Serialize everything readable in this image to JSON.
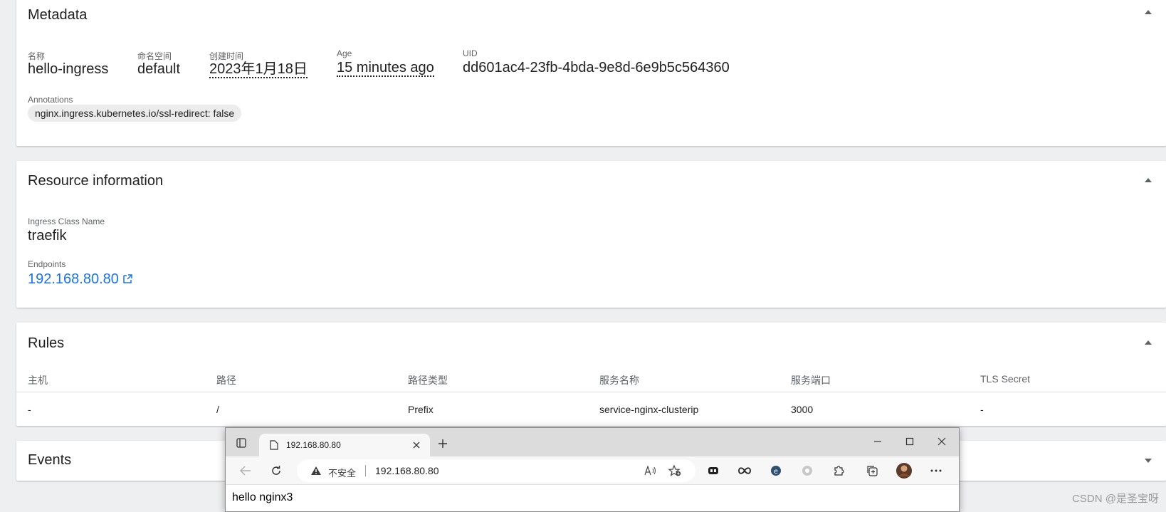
{
  "metadata": {
    "title": "Metadata",
    "fields": {
      "name": {
        "label": "名称",
        "value": "hello-ingress"
      },
      "namespace": {
        "label": "命名空间",
        "value": "default"
      },
      "created": {
        "label": "创建时间",
        "value": "2023年1月18日"
      },
      "age": {
        "label": "Age",
        "value": "15 minutes ago"
      },
      "uid": {
        "label": "UID",
        "value": "dd601ac4-23fb-4bda-9e8d-6e9b5c564360"
      }
    },
    "annotations_label": "Annotations",
    "annotation_chip": "nginx.ingress.kubernetes.io/ssl-redirect: false"
  },
  "resource": {
    "title": "Resource information",
    "ingress_class_label": "Ingress Class Name",
    "ingress_class_value": "traefik",
    "endpoints_label": "Endpoints",
    "endpoint_value": "192.168.80.80"
  },
  "rules": {
    "title": "Rules",
    "headers": [
      "主机",
      "路径",
      "路径类型",
      "服务名称",
      "服务端口",
      "TLS Secret"
    ],
    "rows": [
      [
        "-",
        "/",
        "Prefix",
        "service-nginx-clusterip",
        "3000",
        "-"
      ]
    ]
  },
  "events": {
    "title": "Events"
  },
  "browser": {
    "tab_title": "192.168.80.80",
    "insecure_label": "不安全",
    "url": "192.168.80.80",
    "page_text": "hello nginx3"
  },
  "watermark": "CSDN @是圣宝呀",
  "colors": {
    "link": "#1a73e8",
    "background": "#eeeff0"
  }
}
